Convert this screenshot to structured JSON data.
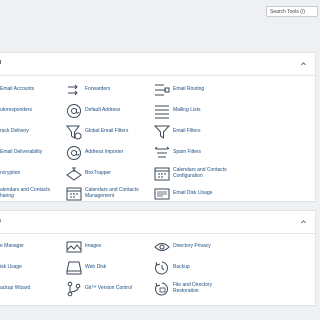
{
  "search": {
    "placeholder": "Search Tools (/)"
  },
  "email": {
    "title": "il",
    "items": [
      {
        "label": "Email Accounts"
      },
      {
        "label": "Forwarders"
      },
      {
        "label": "Email Routing"
      },
      {
        "label": "utoresponders"
      },
      {
        "label": "Default Address"
      },
      {
        "label": "Mailing Lists"
      },
      {
        "label": "rack Delivery"
      },
      {
        "label": "Global Email Filters"
      },
      {
        "label": "Email Filters"
      },
      {
        "label": "Email Deliverability"
      },
      {
        "label": "Address Importer"
      },
      {
        "label": "Spam Filters"
      },
      {
        "label": "ncryption"
      },
      {
        "label": "BoxTrapper"
      },
      {
        "label": "Calendars and Contacts Configuration"
      },
      {
        "label": "alendars and Contacts haring"
      },
      {
        "label": "Calendars and Contacts Management"
      },
      {
        "label": "Email Disk Usage"
      }
    ]
  },
  "files": {
    "title": "s",
    "items": [
      {
        "label": "e Manager"
      },
      {
        "label": "Images"
      },
      {
        "label": "Directory Privacy"
      },
      {
        "label": "isk Usage"
      },
      {
        "label": "Web Disk"
      },
      {
        "label": "Backup"
      },
      {
        "label": "ackup Wizard"
      },
      {
        "label": "Git™ Version Control"
      },
      {
        "label": "File and Directory Restoration"
      }
    ]
  },
  "colors": {
    "link": "#1e4f80",
    "icon": "#3b4a5a",
    "bg": "#eef0f2"
  }
}
